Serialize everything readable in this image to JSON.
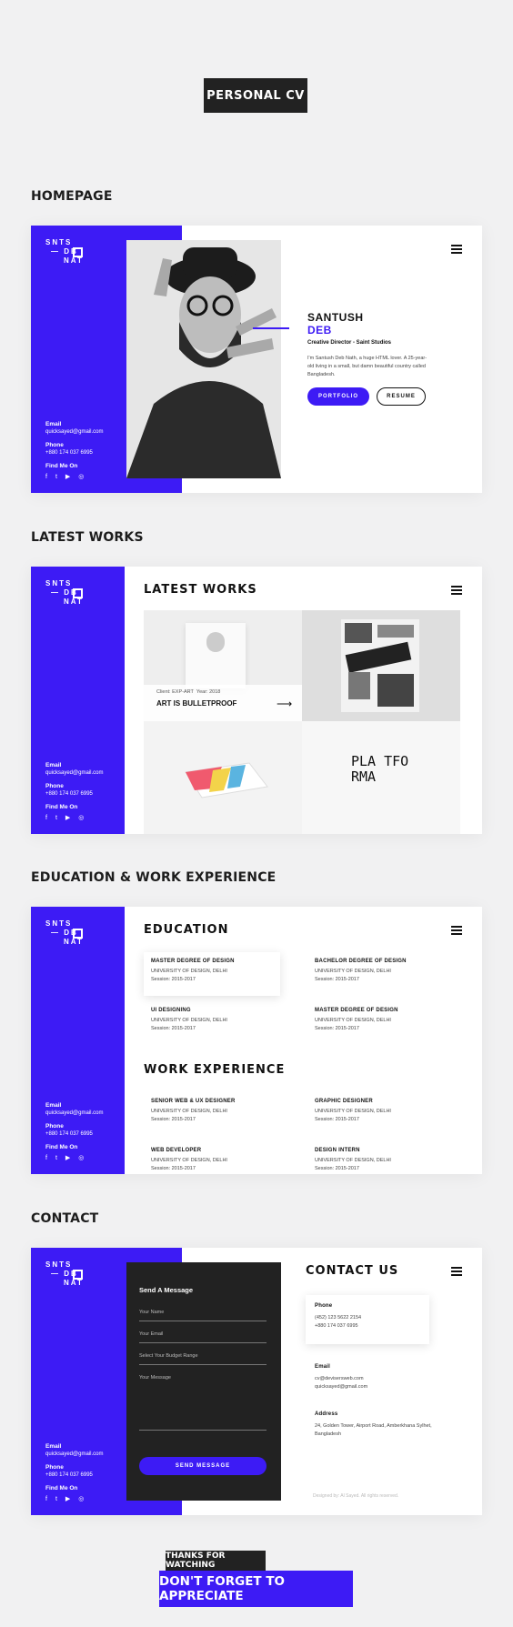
{
  "header": {
    "title": "PERSONAL CV"
  },
  "sections": {
    "homepage": "HOMEPAGE",
    "latest_works": "LATEST WORKS",
    "education": "EDUCATION & WORK EXPERIENCE",
    "contact": "CONTACT"
  },
  "logo": {
    "line1": "SNTS",
    "line2": "DB",
    "line3": "NAT"
  },
  "sidebar": {
    "email_label": "Email",
    "email": "quicksayed@gmail.com",
    "phone_label": "Phone",
    "phone": "+880 174 037 6995",
    "find_label": "Find Me On",
    "socials": [
      "facebook-icon",
      "twitter-icon",
      "youtube-icon",
      "dribbble-icon"
    ]
  },
  "home": {
    "first_name": "SANTUSH",
    "last_name": "DEB",
    "role": "Creative Director - Saint Studios",
    "bio": "I'm Santush Deb Nath, a huge HTML lover. A 25-year-old living in a small, but damn beautiful country called Bangladesh.",
    "portfolio_btn": "PORTFOLIO",
    "resume_btn": "RESUME"
  },
  "works": {
    "title": "LATEST WORKS",
    "client": "Client: EXP-ART",
    "year": "Year: 2018",
    "project": "ART IS BULLETPROOF",
    "tile4_text": "PLA TFO RMA"
  },
  "education": {
    "title": "EDUCATION",
    "items": [
      {
        "title": "MASTER DEGREE OF DESIGN",
        "place": "UNIVERSITY OF DESIGN, DELHI",
        "session": "Session: 2015-2017"
      },
      {
        "title": "BACHELOR DEGREE OF DESIGN",
        "place": "UNIVERSITY OF DESIGN, DELHI",
        "session": "Session: 2015-2017"
      },
      {
        "title": "UI DESIGNING",
        "place": "UNIVERSITY OF DESIGN, DELHI",
        "session": "Session: 2015-2017"
      },
      {
        "title": "MASTER DEGREE OF DESIGN",
        "place": "UNIVERSITY OF DESIGN, DELHI",
        "session": "Session: 2015-2017"
      }
    ]
  },
  "experience": {
    "title": "WORK EXPERIENCE",
    "items": [
      {
        "title": "SENIOR WEB & UX DESIGNER",
        "place": "UNIVERSITY OF DESIGN, DELHI",
        "session": "Session: 2015-2017"
      },
      {
        "title": "GRAPHIC DESIGNER",
        "place": "UNIVERSITY OF DESIGN, DELHI",
        "session": "Session: 2015-2017"
      },
      {
        "title": "WEB DEVELOPER",
        "place": "UNIVERSITY OF DESIGN, DELHI",
        "session": "Session: 2015-2017"
      },
      {
        "title": "DESIGN INTERN",
        "place": "UNIVERSITY OF DESIGN, DELHI",
        "session": "Session: 2015-2017"
      }
    ]
  },
  "contact": {
    "form_title": "Send A Message",
    "name_placeholder": "Your Name",
    "email_placeholder": "Your Email",
    "budget_placeholder": "Select Your Budget Range",
    "message_placeholder": "Your Message",
    "send_btn": "SEND MESSAGE",
    "title": "CONTACT US",
    "phone_label": "Phone",
    "phone1": "(452) 123 5622 2154",
    "phone2": "+880 174 037 6995",
    "email_label": "Email",
    "email1": "cv@devisersweb.com",
    "email2": "quicksayed@gmail.com",
    "address_label": "Address",
    "address": "24, Golden Tower, Airport Road, Amberkhana Sylhet, Bangladesh",
    "footer": "Designed by: Al Sayed. All rights reserved."
  },
  "footer": {
    "thanks": "THANKS FOR WATCHING",
    "appreciate": "DON'T FORGET TO APPRECIATE"
  },
  "colors": {
    "accent": "#3d1bf5",
    "dark": "#222222"
  }
}
